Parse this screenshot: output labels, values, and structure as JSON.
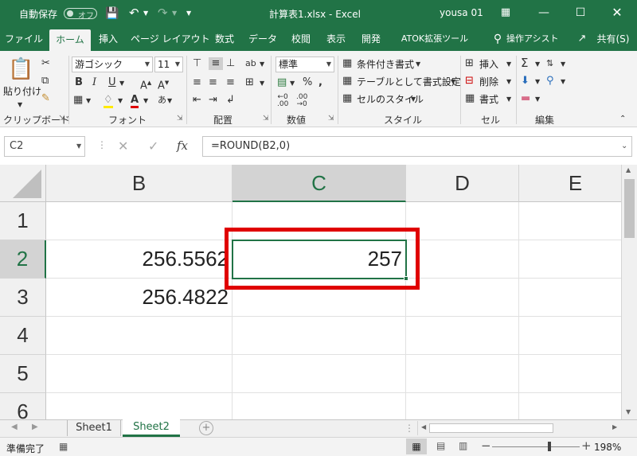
{
  "title_bar": {
    "autosave_label": "自動保存",
    "autosave_state": "オフ",
    "document_title": "計算表1.xlsx  -  Excel",
    "user": "yousa 01"
  },
  "tabs": [
    "ファイル",
    "ホーム",
    "挿入",
    "ページ レイアウト",
    "数式",
    "データ",
    "校閲",
    "表示",
    "開発",
    "ATOK拡張ツール"
  ],
  "tell_me": "操作アシスト",
  "share": "共有(S)",
  "ribbon": {
    "clipboard": {
      "paste": "貼り付け",
      "label": "クリップボード"
    },
    "font": {
      "name": "游ゴシック",
      "size": "11",
      "label": "フォント"
    },
    "alignment": {
      "label": "配置"
    },
    "number": {
      "format": "標準",
      "label": "数値"
    },
    "styles": {
      "conditional": "条件付き書式",
      "as_table": "テーブルとして書式設定",
      "cell_styles": "セルのスタイル",
      "label": "スタイル"
    },
    "cells": {
      "insert": "挿入",
      "delete": "削除",
      "format": "書式",
      "label": "セル"
    },
    "editing": {
      "label": "編集"
    }
  },
  "formula_bar": {
    "name_box": "C2",
    "formula": "=ROUND(B2,0)"
  },
  "grid": {
    "columns": [
      "B",
      "C",
      "D",
      "E"
    ],
    "rows": [
      "1",
      "2",
      "3",
      "4",
      "5",
      "6"
    ],
    "cells": {
      "B2": "256.5562",
      "B3": "256.4822",
      "C2": "257"
    },
    "selected_cell": "C2"
  },
  "sheets": [
    "Sheet1",
    "Sheet2"
  ],
  "active_sheet": "Sheet2",
  "status": {
    "ready": "準備完了",
    "zoom": "198%"
  },
  "colors": {
    "excel_green": "#217346",
    "highlight_box": "#e00000"
  }
}
